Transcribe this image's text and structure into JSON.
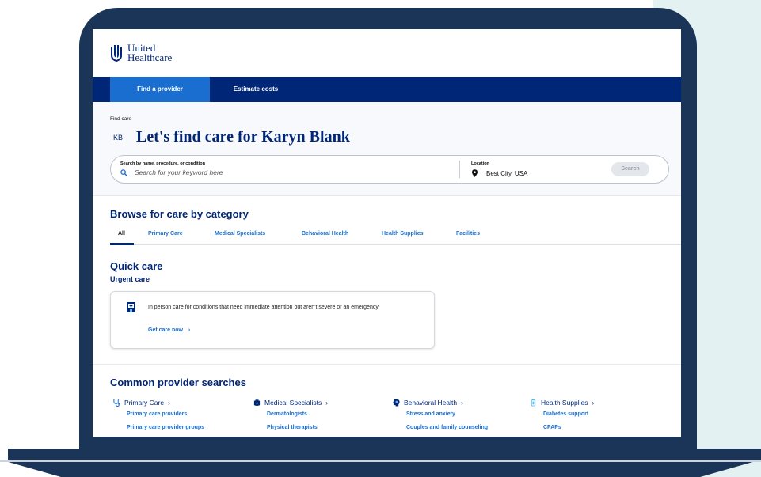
{
  "brand": {
    "line1": "United",
    "line2": "Healthcare"
  },
  "nav": {
    "tabs": [
      {
        "label": "Find a provider",
        "active": true
      },
      {
        "label": "Estimate costs",
        "active": false
      }
    ]
  },
  "hero": {
    "breadcrumb": "Find care",
    "initials": "KB",
    "heading": "Let's find care for Karyn Blank",
    "search": {
      "label": "Search by name, procedure, or condition",
      "placeholder": "Search for your keyword here",
      "value": ""
    },
    "location": {
      "label": "Location",
      "value": "Best City, USA"
    },
    "search_button": "Search"
  },
  "browse": {
    "title": "Browse for care by category",
    "tabs": [
      "All",
      "Primary Care",
      "Medical Specialists",
      "Behavioral Health",
      "Health Supplies",
      "Facilities"
    ],
    "active_tab": "All"
  },
  "quick_care": {
    "title": "Quick care",
    "subtitle": "Urgent care",
    "card": {
      "icon": "hospital-icon",
      "text": "In person care for conditions that need immediate attention but aren't severe or an emergency.",
      "link": "Get care now"
    }
  },
  "common": {
    "title": "Common provider searches",
    "columns": [
      {
        "label": "Primary Care",
        "icon": "stethoscope-icon",
        "links": [
          "Primary care providers",
          "Primary care provider groups"
        ]
      },
      {
        "label": "Medical Specialists",
        "icon": "medical-bag-icon",
        "links": [
          "Dermatologists",
          "Physical therapists"
        ]
      },
      {
        "label": "Behavioral Health",
        "icon": "head-icon",
        "links": [
          "Stress and anxiety",
          "Couples and family counseling"
        ]
      },
      {
        "label": "Health Supplies",
        "icon": "medical-supply-icon",
        "links": [
          "Diabetes support",
          "CPAPs"
        ]
      }
    ]
  },
  "colors": {
    "navy": "#002677",
    "accent_blue": "#196ecf",
    "frame": "#1b3558",
    "side_panel": "#e3f1f2"
  }
}
